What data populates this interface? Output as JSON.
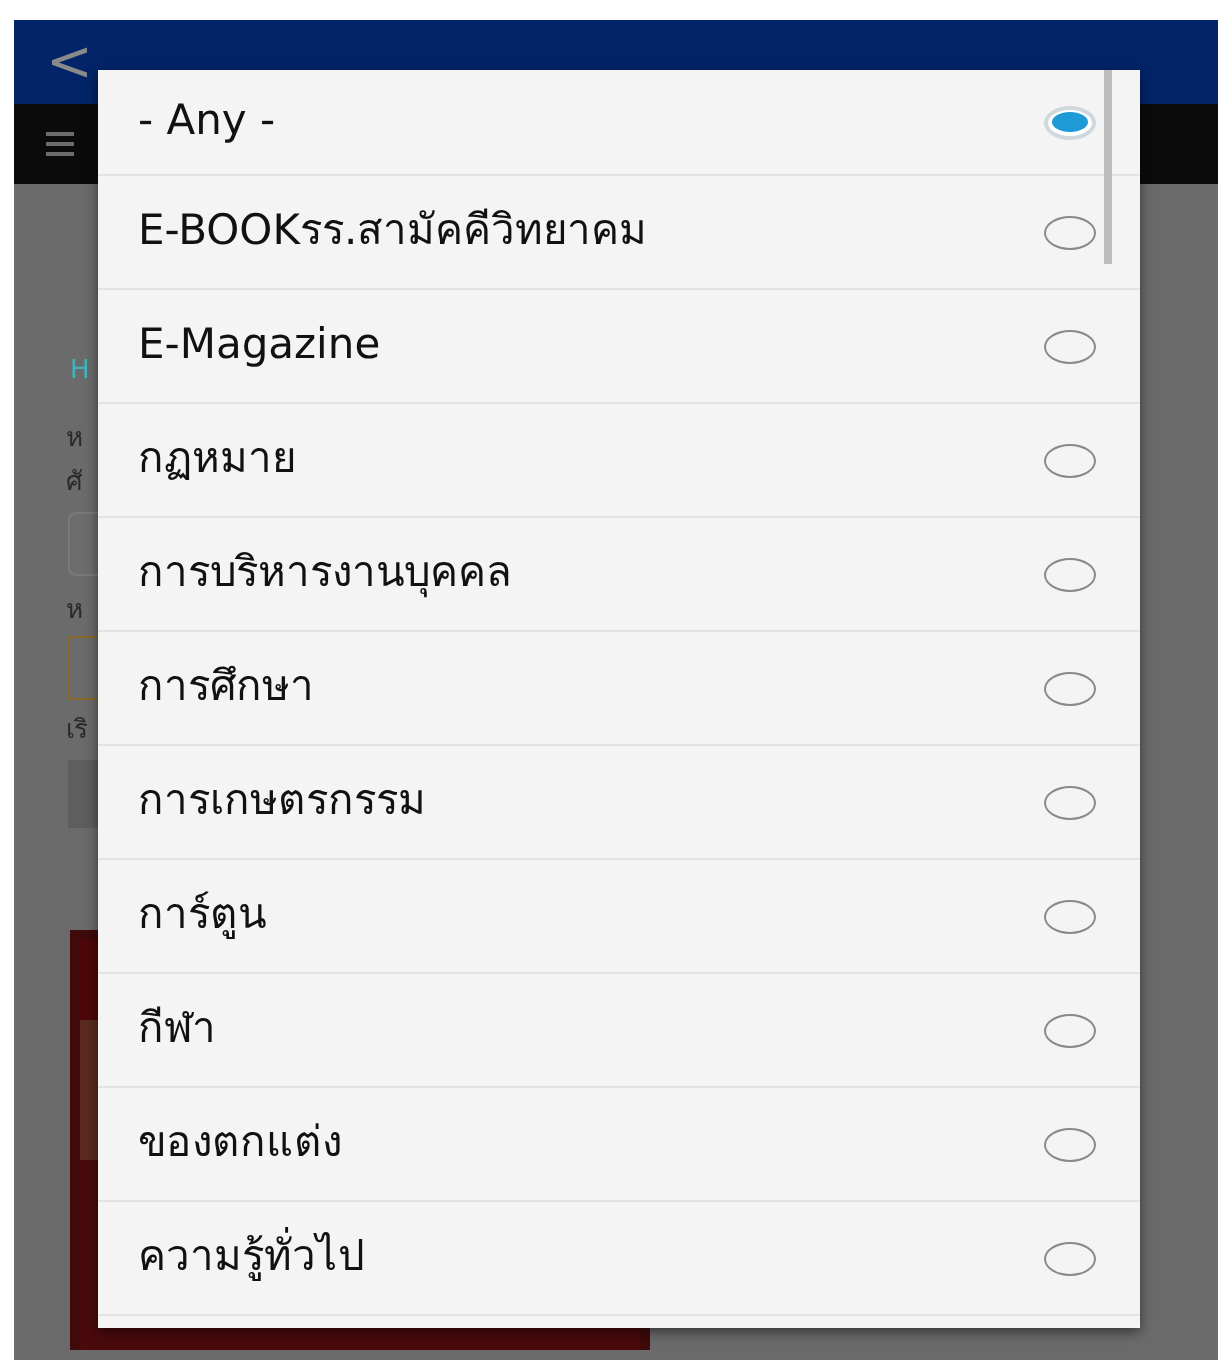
{
  "app_bar": {
    "back": "<"
  },
  "background_form": {
    "link": "H",
    "labels": [
      "ห",
      "ศั",
      "ห",
      "เริ"
    ]
  },
  "dialog": {
    "options": [
      {
        "label": "- Any -",
        "selected": true
      },
      {
        "label": "E-BOOKรร.สามัคคีวิทยาคม",
        "selected": false
      },
      {
        "label": "E-Magazine",
        "selected": false
      },
      {
        "label": "กฏหมาย",
        "selected": false
      },
      {
        "label": "การบริหารงานบุคคล",
        "selected": false
      },
      {
        "label": "การศึกษา",
        "selected": false
      },
      {
        "label": "การเกษตรกรรม",
        "selected": false
      },
      {
        "label": "การ์ตูน",
        "selected": false
      },
      {
        "label": "กีฬา",
        "selected": false
      },
      {
        "label": "ของตกแต่ง",
        "selected": false
      },
      {
        "label": "ความรู้ทั่วไป",
        "selected": false
      }
    ]
  }
}
